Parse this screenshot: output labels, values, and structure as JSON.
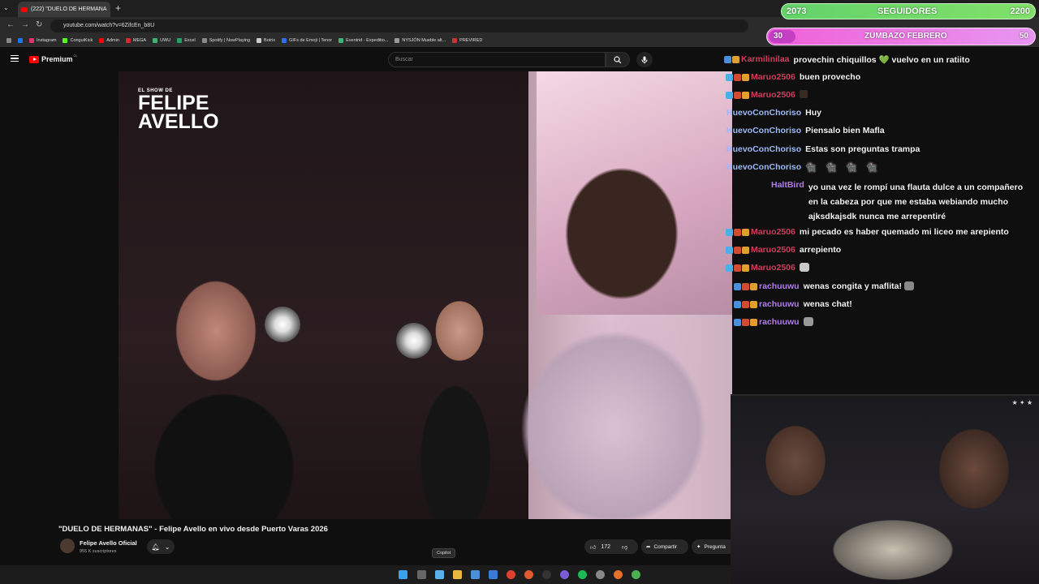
{
  "browser": {
    "tab_title": "(222) \"DUELO DE HERMANA",
    "url": "youtube.com/watch?v=6ZifcEn_b8U",
    "bookmarks": [
      "Instagram",
      "ConguiKick",
      "Admin",
      "MEGA",
      "UWU",
      "Excel",
      "Spotify | NowPlaying",
      "Botrix",
      "GIFs de Emoji | Tenor",
      "Eventrid - Expeditio...",
      "NYSJÓN Mueble alt...",
      "PREVIRED"
    ]
  },
  "youtube": {
    "logo_text": "Premium",
    "logo_region": "CL",
    "search_placeholder": "Buscar",
    "video_title": "\"DUELO DE HERMANAS\" - Felipe Avello en vivo desde Puerto Varas 2026",
    "channel_name": "Felipe Avello Oficial",
    "subscribers": "955 K suscriptores",
    "likes": "172",
    "share_label": "Compartir",
    "ask_label": "Pregunta",
    "show_logo_small": "EL SHOW DE",
    "show_logo_line1": "FELIPE",
    "show_logo_line2": "AVELLO"
  },
  "taskbar": {
    "tooltip": "Copilot"
  },
  "followers_bar": {
    "current": "2073",
    "label": "SEGUIDORES",
    "goal": "2200",
    "progress": 0.45,
    "color": "#6fd96a"
  },
  "zumba_bar": {
    "current": "30",
    "label": "ZUMBAZO FEBRERO",
    "goal": "50",
    "progress": 0.1,
    "color": "#ee7be6"
  },
  "chat": [
    {
      "user": "Karmilinilaa",
      "text": "provechin chiquillos 💚 vuelvo en un ratiito",
      "color": "red"
    },
    {
      "user": "Maruo2506",
      "text": "buen provecho",
      "color": "red"
    },
    {
      "user": "Maruo2506",
      "text": "",
      "color": "red"
    },
    {
      "user": "HuevoConChoriso",
      "text": "Huy",
      "color": "blue"
    },
    {
      "user": "HuevoConChoriso",
      "text": "Piensalo bien Mafla",
      "color": "blue"
    },
    {
      "user": "HuevoConChoriso",
      "text": "Estas son preguntas trampa",
      "color": "blue"
    },
    {
      "user": "HuevoConChoriso",
      "text": "",
      "color": "blue"
    },
    {
      "user": "HaltBird",
      "text": "yo una vez le rompí una flauta dulce a un compañero en la cabeza por que me estaba webiando mucho ajksdkajsdk nunca me arrepentiré",
      "color": "purple"
    },
    {
      "user": "Maruo2506",
      "text": "mi pecado es haber quemado mi liceo me arepiento",
      "color": "red"
    },
    {
      "user": "Maruo2506",
      "text": "arrepiento",
      "color": "red"
    },
    {
      "user": "Maruo2506",
      "text": "",
      "color": "red"
    },
    {
      "user": "rachuuwu",
      "text": "wenas congita y maflita!",
      "color": "purple"
    },
    {
      "user": "rachuuwu",
      "text": "wenas chat!",
      "color": "purple"
    },
    {
      "user": "rachuuwu",
      "text": "",
      "color": "purple"
    }
  ]
}
